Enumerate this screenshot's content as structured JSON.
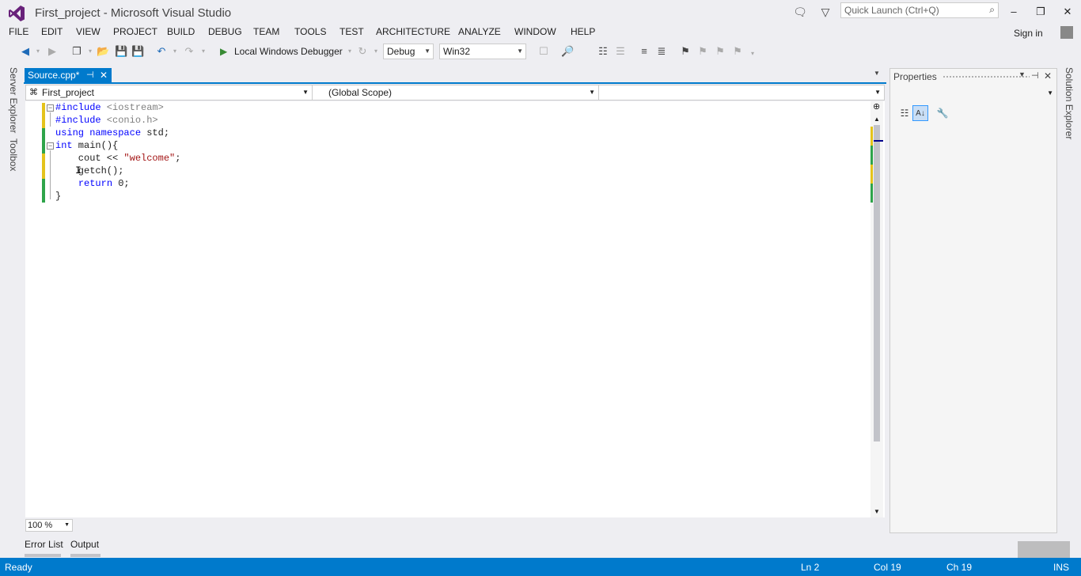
{
  "window": {
    "title": "First_project - Microsoft Visual Studio",
    "quick_launch_placeholder": "Quick Launch (Ctrl+Q)",
    "sign_in": "Sign in"
  },
  "menu": [
    "FILE",
    "EDIT",
    "VIEW",
    "PROJECT",
    "BUILD",
    "DEBUG",
    "TEAM",
    "TOOLS",
    "TEST",
    "ARCHITECTURE",
    "ANALYZE",
    "WINDOW",
    "HELP"
  ],
  "toolbar": {
    "debugger_label": "Local Windows Debugger",
    "configuration": "Debug",
    "platform": "Win32"
  },
  "left_rail": [
    "Server Explorer",
    "Toolbox"
  ],
  "right_rail": [
    "Solution Explorer"
  ],
  "editor": {
    "tab_label": "Source.cpp*",
    "nav_project": "First_project",
    "nav_scope": "(Global Scope)",
    "nav_member": "",
    "zoom": "100 %",
    "code": [
      {
        "parts": [
          {
            "t": "#include",
            "c": "pp-kw"
          },
          {
            "t": " <iostream>",
            "c": "pp"
          }
        ]
      },
      {
        "parts": [
          {
            "t": "#include",
            "c": "pp-kw"
          },
          {
            "t": " <conio.h>",
            "c": "pp"
          }
        ]
      },
      {
        "parts": [
          {
            "t": "using",
            "c": "kw"
          },
          {
            "t": " ",
            "c": ""
          },
          {
            "t": "namespace",
            "c": "kw"
          },
          {
            "t": " std;",
            "c": ""
          }
        ]
      },
      {
        "parts": [
          {
            "t": "int",
            "c": "kw"
          },
          {
            "t": " main(){",
            "c": ""
          }
        ]
      },
      {
        "parts": [
          {
            "t": "    cout << ",
            "c": ""
          },
          {
            "t": "\"welcome\"",
            "c": "str"
          },
          {
            "t": ";",
            "c": ""
          }
        ]
      },
      {
        "parts": [
          {
            "t": "    getch();",
            "c": ""
          }
        ]
      },
      {
        "parts": [
          {
            "t": "    ",
            "c": ""
          },
          {
            "t": "return",
            "c": "kw"
          },
          {
            "t": " 0;",
            "c": ""
          }
        ]
      },
      {
        "parts": [
          {
            "t": "}",
            "c": ""
          }
        ]
      }
    ]
  },
  "properties": {
    "title": "Properties"
  },
  "bottom_tabs": [
    "Error List",
    "Output"
  ],
  "status": {
    "state": "Ready",
    "line": "Ln 2",
    "col": "Col 19",
    "ch": "Ch 19",
    "mode": "INS"
  },
  "colors": {
    "accent": "#007acc",
    "change_saved": "#2ea44a",
    "change_unsaved": "#e4c31b"
  }
}
